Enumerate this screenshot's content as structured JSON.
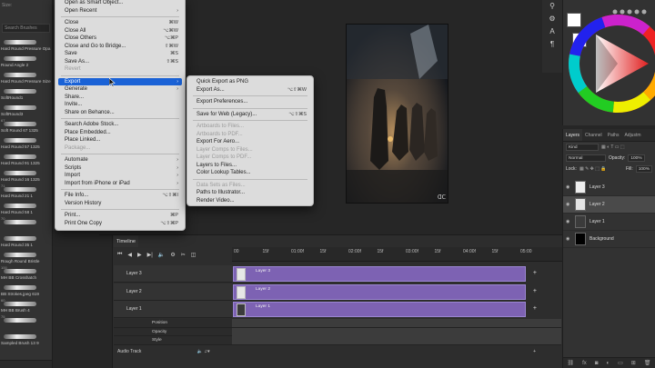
{
  "brushes": {
    "tab_label": "Size:",
    "search_placeholder": "Search Brushes",
    "items": [
      {
        "num": "",
        "name": "Hard Round Pressure Opa"
      },
      {
        "num": "",
        "name": "Round Angle 2"
      },
      {
        "num": "",
        "name": "Hard Round Pressure Size"
      },
      {
        "num": "",
        "name": "SoftRound1"
      },
      {
        "num": "",
        "name": "SoftRound3"
      },
      {
        "num": "67",
        "name": "Soft Round 67 1325"
      },
      {
        "num": "",
        "name": "Hard Round 57 1325"
      },
      {
        "num": "",
        "name": "Hard Round 91 1325"
      },
      {
        "num": "",
        "name": "Hard Round 16 1325"
      },
      {
        "num": "71",
        "name": "Hard Round 21 1"
      },
      {
        "num": "",
        "name": "Hard Round 58 1"
      },
      {
        "num": "70",
        "name": ""
      },
      {
        "num": "",
        "name": "Hard Round 35 1"
      },
      {
        "num": "",
        "name": "Rough Round Bristle"
      },
      {
        "num": "100",
        "name": "MH BB Crosshatch"
      },
      {
        "num": "",
        "name": "BB Strokes.jpeg 619"
      },
      {
        "num": "60",
        "name": "MH BB Brush 4"
      },
      {
        "num": "75",
        "name": ""
      },
      {
        "num": "",
        "name": "Sampled Brush 13 9"
      }
    ]
  },
  "file_menu": {
    "items": [
      {
        "label": "Open as Smart Object...",
        "shortcut": "",
        "type": "item"
      },
      {
        "label": "Open Recent",
        "shortcut": "›",
        "type": "item"
      },
      {
        "type": "sep"
      },
      {
        "label": "Close",
        "shortcut": "⌘W",
        "type": "item"
      },
      {
        "label": "Close All",
        "shortcut": "⌥⌘W",
        "type": "item"
      },
      {
        "label": "Close Others",
        "shortcut": "⌥⌘P",
        "type": "item"
      },
      {
        "label": "Close and Go to Bridge...",
        "shortcut": "⇧⌘W",
        "type": "item"
      },
      {
        "label": "Save",
        "shortcut": "⌘S",
        "type": "item"
      },
      {
        "label": "Save As...",
        "shortcut": "⇧⌘S",
        "type": "item"
      },
      {
        "label": "Revert",
        "shortcut": "",
        "type": "disabled"
      },
      {
        "type": "sep"
      },
      {
        "label": "Export",
        "shortcut": "›",
        "type": "highlight"
      },
      {
        "label": "Generate",
        "shortcut": "›",
        "type": "item"
      },
      {
        "label": "Share...",
        "shortcut": "",
        "type": "item"
      },
      {
        "label": "Invite...",
        "shortcut": "",
        "type": "item"
      },
      {
        "label": "Share on Behance...",
        "shortcut": "",
        "type": "item"
      },
      {
        "type": "sep"
      },
      {
        "label": "Search Adobe Stock...",
        "shortcut": "",
        "type": "item"
      },
      {
        "label": "Place Embedded...",
        "shortcut": "",
        "type": "item"
      },
      {
        "label": "Place Linked...",
        "shortcut": "",
        "type": "item"
      },
      {
        "label": "Package...",
        "shortcut": "",
        "type": "disabled"
      },
      {
        "type": "sep"
      },
      {
        "label": "Automate",
        "shortcut": "›",
        "type": "item"
      },
      {
        "label": "Scripts",
        "shortcut": "›",
        "type": "item"
      },
      {
        "label": "Import",
        "shortcut": "›",
        "type": "item"
      },
      {
        "label": "Import from iPhone or iPad",
        "shortcut": "›",
        "type": "item"
      },
      {
        "type": "sep"
      },
      {
        "label": "File Info...",
        "shortcut": "⌥⇧⌘I",
        "type": "item"
      },
      {
        "label": "Version History",
        "shortcut": "",
        "type": "item"
      },
      {
        "type": "sep"
      },
      {
        "label": "Print...",
        "shortcut": "⌘P",
        "type": "item"
      },
      {
        "label": "Print One Copy",
        "shortcut": "⌥⇧⌘P",
        "type": "item"
      }
    ]
  },
  "export_menu": {
    "items": [
      {
        "label": "Quick Export as PNG",
        "shortcut": "",
        "type": "item"
      },
      {
        "label": "Export As...",
        "shortcut": "⌥⇧⌘W",
        "type": "item"
      },
      {
        "type": "sep"
      },
      {
        "label": "Export Preferences...",
        "shortcut": "",
        "type": "item"
      },
      {
        "type": "sep"
      },
      {
        "label": "Save for Web (Legacy)...",
        "shortcut": "⌥⇧⌘S",
        "type": "item"
      },
      {
        "type": "sep"
      },
      {
        "label": "Artboards to Files...",
        "shortcut": "",
        "type": "disabled"
      },
      {
        "label": "Artboards to PDF...",
        "shortcut": "",
        "type": "disabled"
      },
      {
        "label": "Export For Aero...",
        "shortcut": "",
        "type": "item"
      },
      {
        "label": "Layer Comps to Files...",
        "shortcut": "",
        "type": "disabled"
      },
      {
        "label": "Layer Comps to PDF...",
        "shortcut": "",
        "type": "disabled"
      },
      {
        "label": "Layers to Files...",
        "shortcut": "",
        "type": "item"
      },
      {
        "label": "Color Lookup Tables...",
        "shortcut": "",
        "type": "item"
      },
      {
        "type": "sep"
      },
      {
        "label": "Data Sets as Files...",
        "shortcut": "",
        "type": "disabled"
      },
      {
        "label": "Paths to Illustrator...",
        "shortcut": "",
        "type": "item"
      },
      {
        "label": "Render Video...",
        "shortcut": "",
        "type": "item"
      }
    ]
  },
  "layers": {
    "tabs": [
      "Layers",
      "Channel",
      "Paths",
      "Adjustm"
    ],
    "kind_label": "Kind",
    "blend_mode": "Normal",
    "opacity_label": "Opacity:",
    "opacity_value": "100%",
    "lock_label": "Lock:",
    "fill_label": "Fill:",
    "fill_value": "100%",
    "items": [
      {
        "name": "Layer 3",
        "selected": false,
        "thumb": "#eeeeee"
      },
      {
        "name": "Layer 2",
        "selected": true,
        "thumb": "#e4e4e4"
      },
      {
        "name": "Layer 1",
        "selected": false,
        "thumb": "#3b3b3b"
      },
      {
        "name": "Background",
        "selected": false,
        "thumb": "#000000"
      }
    ]
  },
  "timeline": {
    "tab_label": "Timeline",
    "ruler": [
      "00",
      "15f",
      "01:00f",
      "15f",
      "02:00f",
      "15f",
      "03:00f",
      "15f",
      "04:00f",
      "15f",
      "05:00"
    ],
    "tracks": [
      {
        "label": "Layer 3",
        "bar_name": "Layer 3"
      },
      {
        "label": "Layer 2",
        "bar_name": "Layer 2"
      },
      {
        "label": "Layer 1",
        "bar_name": "Layer 1"
      }
    ],
    "properties": [
      "Position",
      "Opacity",
      "Style"
    ],
    "audio_label": "Audio Track"
  },
  "colors": {
    "accent": "#1a62d6",
    "track": "#7d62b3",
    "foreground": "#ffffff",
    "background": "#ffffff"
  }
}
